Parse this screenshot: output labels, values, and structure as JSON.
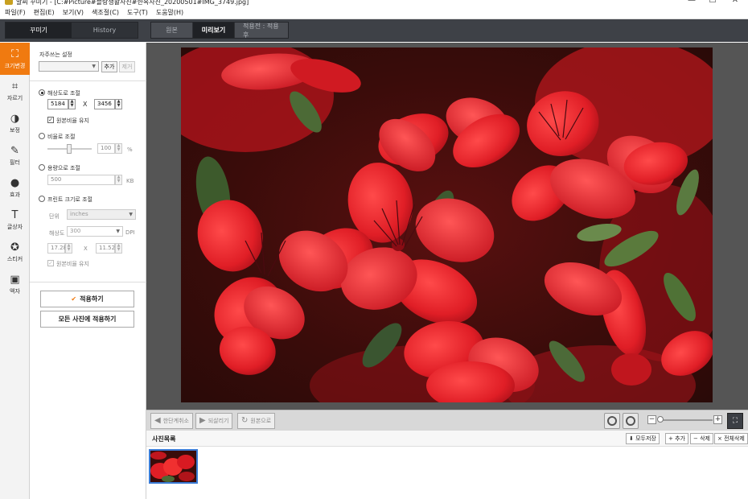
{
  "window": {
    "title": "알씨 꾸미기 - [C:#Picture#블랑생활사진#한옥사진_20200501#IMG_3749.jpg]",
    "min": "—",
    "max": "☐",
    "close": "✕"
  },
  "menu": [
    "파일(F)",
    "편집(E)",
    "보기(V)",
    "색조절(C)",
    "도구(T)",
    "도움말(H)"
  ],
  "left_tabs": [
    "꾸미기",
    "History"
  ],
  "view_tabs": [
    "원본",
    "미리보기",
    "적용전 : 적용후"
  ],
  "tools": [
    {
      "label": "크기변경",
      "icon": "⛶"
    },
    {
      "label": "자르기",
      "icon": "⌗"
    },
    {
      "label": "보정",
      "icon": "◑"
    },
    {
      "label": "필터",
      "icon": "✎"
    },
    {
      "label": "효과",
      "icon": "●"
    },
    {
      "label": "글상자",
      "icon": "T"
    },
    {
      "label": "스티커",
      "icon": "✪"
    },
    {
      "label": "액자",
      "icon": "▣"
    }
  ],
  "panel": {
    "favorites_label": "자주쓰는 설정",
    "add": "추가",
    "delete": "제거",
    "res_label": "해상도로 조절",
    "width": "5184",
    "x": "X",
    "height": "3456",
    "keep_ratio": "원본비율 유지",
    "ratio_label": "비율로 조절",
    "ratio_value": "100",
    "percent": "%",
    "size_label": "용량으로 조절",
    "size_value": "500",
    "kb": "KB",
    "print_label": "프린트 크기로 조절",
    "unit_label": "단위",
    "unit_value": "inches",
    "dpi_label": "해상도",
    "dpi_value": "300",
    "dpi_unit": "DPI",
    "pw": "17.28",
    "px": "X",
    "ph": "11.52",
    "keep_ratio2": "원본비율 유지",
    "apply": "적용하기",
    "apply_all": "모든 사진에 적용하기"
  },
  "bottom": {
    "undo": "한단계취소",
    "redo": "되살리기",
    "reset": "원본으로",
    "rot_left": "90",
    "rot_right": "90",
    "zoom_out": "−",
    "zoom_in": "+",
    "zoom_level": 0.05
  },
  "photolist": {
    "title": "사진목록",
    "save_all": "모두저장",
    "add": "+ 추가",
    "delete": "− 삭제",
    "delete_all": "× 전체삭제"
  }
}
